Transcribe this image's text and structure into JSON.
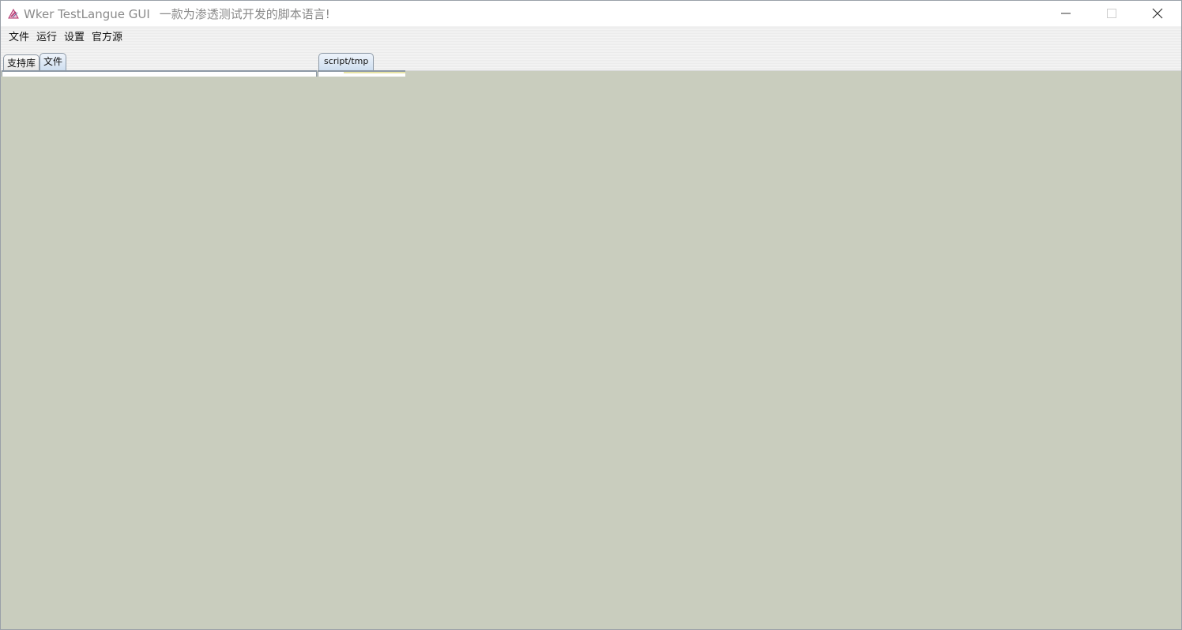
{
  "window": {
    "app_name": "Wker TestLangue GUI",
    "subtitle": "一款为渗透测试开发的脚本语言!",
    "controls": {
      "minimize_icon": "minimize-icon",
      "maximize_icon": "maximize-icon",
      "close_icon": "close-icon"
    }
  },
  "menubar": {
    "items": [
      {
        "label": "文件"
      },
      {
        "label": "运行"
      },
      {
        "label": "设置"
      },
      {
        "label": "官方源"
      }
    ]
  },
  "left_panel": {
    "tabs": [
      {
        "label": "支持库",
        "selected": false
      },
      {
        "label": "文件",
        "selected": true
      }
    ]
  },
  "editor": {
    "tabs": [
      {
        "label": "script/tmp",
        "selected": true
      }
    ]
  },
  "colors": {
    "background": "#c9cdbe",
    "tab_selected": "#cfdff0",
    "tab_border": "#8d99a6"
  }
}
